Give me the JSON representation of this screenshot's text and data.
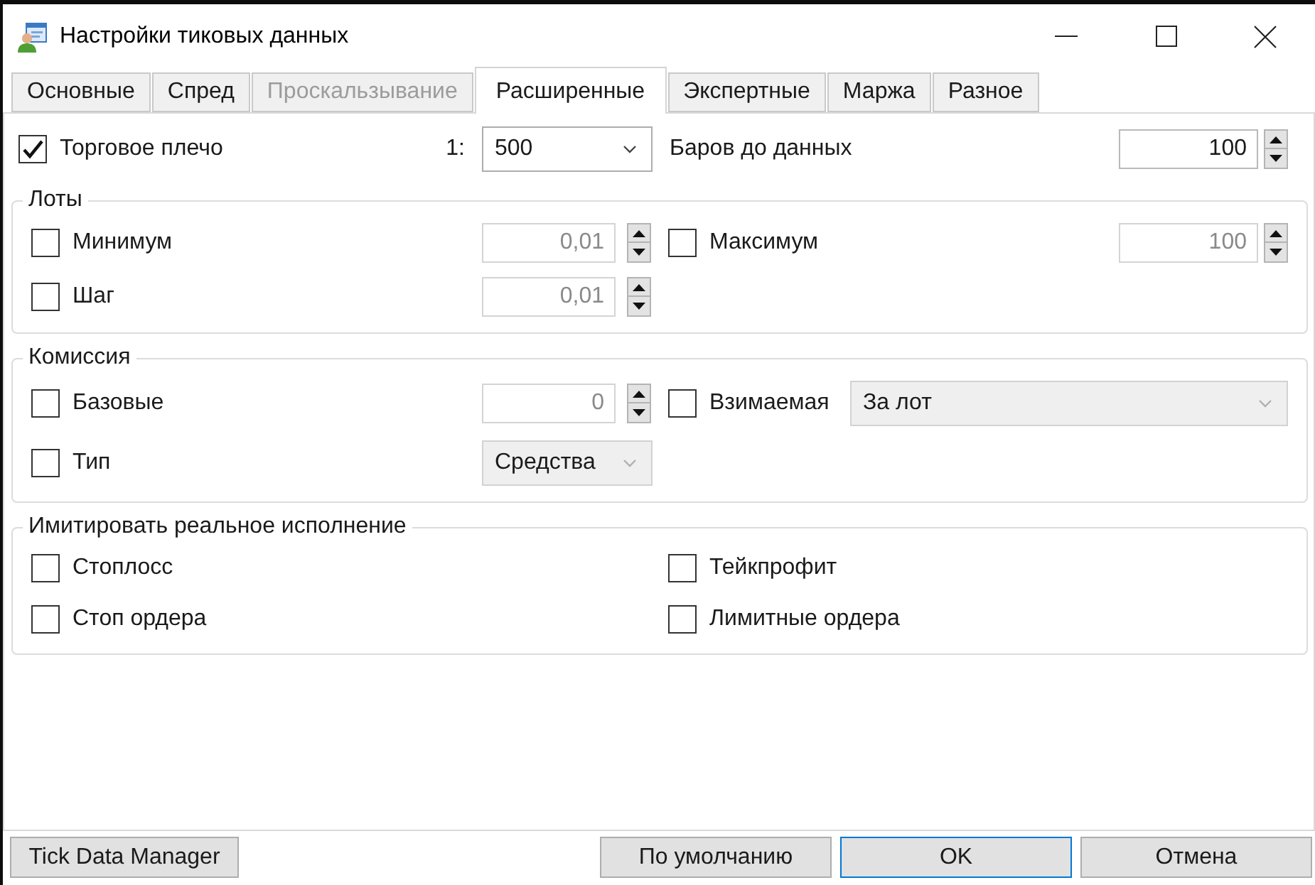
{
  "window": {
    "title": "Настройки тиковых данных"
  },
  "tabs": [
    {
      "label": "Основные",
      "selected": false,
      "disabled": false
    },
    {
      "label": "Спред",
      "selected": false,
      "disabled": false
    },
    {
      "label": "Проскальзывание",
      "selected": false,
      "disabled": true
    },
    {
      "label": "Расширенные",
      "selected": true,
      "disabled": false
    },
    {
      "label": "Экспертные",
      "selected": false,
      "disabled": false
    },
    {
      "label": "Маржа",
      "selected": false,
      "disabled": false
    },
    {
      "label": "Разное",
      "selected": false,
      "disabled": false
    }
  ],
  "top_row": [
    {
      "kind": "checkbox",
      "label": "Торговое плечо",
      "checked": true,
      "prefix": "1:",
      "control": {
        "kind": "dropdown",
        "value": "500",
        "disabled": false
      }
    },
    {
      "kind": "text",
      "label": "Баров до данных",
      "control": {
        "kind": "spin",
        "value": "100",
        "disabled": false
      }
    }
  ],
  "groups": [
    {
      "title": "Лоты",
      "rows": [
        [
          {
            "kind": "checkbox",
            "label": "Минимум",
            "checked": false,
            "control": {
              "kind": "spin",
              "value": "0,01",
              "disabled": true
            }
          },
          {
            "kind": "checkbox",
            "label": "Максимум",
            "checked": false,
            "control": {
              "kind": "spin",
              "value": "100",
              "disabled": true
            }
          }
        ],
        [
          {
            "kind": "checkbox",
            "label": "Шаг",
            "checked": false,
            "control": {
              "kind": "spin",
              "value": "0,01",
              "disabled": true
            }
          }
        ]
      ]
    },
    {
      "title": "Комиссия",
      "rows": [
        [
          {
            "kind": "checkbox",
            "label": "Базовые",
            "checked": false,
            "control": {
              "kind": "spin",
              "value": "0",
              "disabled": true
            }
          },
          {
            "kind": "checkbox",
            "label": "Взимаемая",
            "checked": false,
            "control": {
              "kind": "dropdown",
              "value": "За лот",
              "disabled": true
            }
          }
        ],
        [
          {
            "kind": "checkbox",
            "label": "Тип",
            "checked": false,
            "control": {
              "kind": "dropdown",
              "value": "Средства",
              "disabled": true
            }
          }
        ]
      ]
    },
    {
      "title": "Имитировать реальное исполнение",
      "rows": [
        [
          {
            "kind": "checkbox",
            "label": "Стоплосс",
            "checked": false
          },
          {
            "kind": "checkbox",
            "label": "Тейкпрофит",
            "checked": false
          }
        ],
        [
          {
            "kind": "checkbox",
            "label": "Стоп ордера",
            "checked": false
          },
          {
            "kind": "checkbox",
            "label": "Лимитные ордера",
            "checked": false
          }
        ]
      ]
    }
  ],
  "footer": {
    "left_buttons": [
      {
        "label": "Tick Data Manager",
        "default": false
      }
    ],
    "right_buttons": [
      {
        "label": "По умолчанию",
        "default": false
      },
      {
        "label": "OK",
        "default": true
      },
      {
        "label": "Отмена",
        "default": false
      }
    ]
  }
}
